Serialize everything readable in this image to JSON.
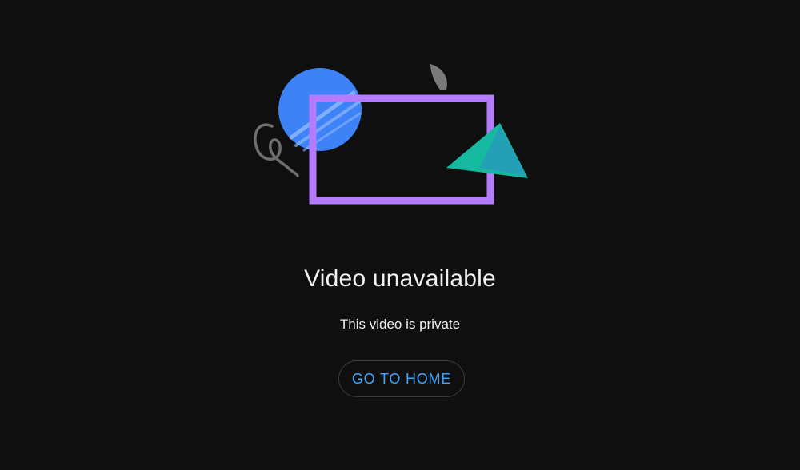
{
  "error": {
    "title": "Video unavailable",
    "message": "This video is private",
    "home_button_label": "GO TO HOME"
  },
  "illustration": {
    "icons": [
      "planet-icon",
      "squiggle-icon",
      "half-moon-icon",
      "frame-icon",
      "triangle-icon"
    ],
    "colors": {
      "planet": "#3d82f6",
      "planet_stripes": "#8fb7ff",
      "frame": "#b57bff",
      "triangle": "#17b8a0",
      "triangle_speckle": "#3b6fe0",
      "squiggle": "#6e6e6e",
      "half_moon": "#7a7a7a"
    }
  },
  "theme": {
    "background": "#0f0f0f",
    "text": "#f1f1f1",
    "accent": "#3ea6ff",
    "button_border": "#3a3a3a"
  }
}
